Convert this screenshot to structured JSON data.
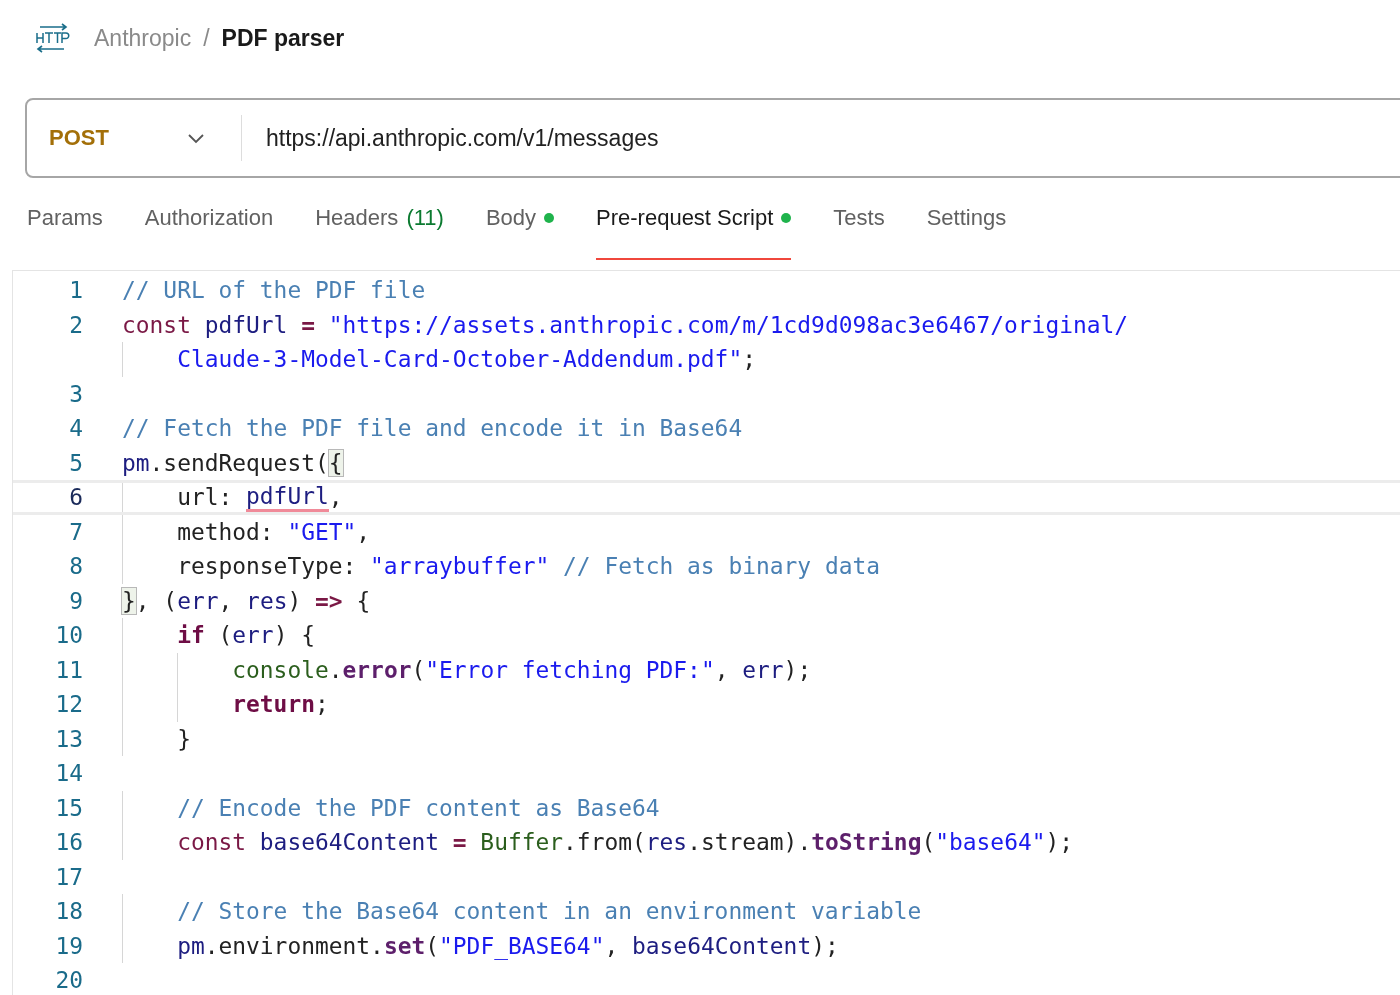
{
  "breadcrumb": {
    "workspace": "Anthropic",
    "separator": "/",
    "request_name": "PDF parser"
  },
  "request": {
    "method": "POST",
    "url": "https://api.anthropic.com/v1/messages"
  },
  "tabs": [
    {
      "label": "Params",
      "selected": false,
      "dot": false
    },
    {
      "label": "Authorization",
      "selected": false,
      "dot": false
    },
    {
      "label": "Headers",
      "count": "(11)",
      "selected": false,
      "dot": false
    },
    {
      "label": "Body",
      "selected": false,
      "dot": true
    },
    {
      "label": "Pre-request Script",
      "selected": true,
      "dot": true
    },
    {
      "label": "Tests",
      "selected": false,
      "dot": false
    },
    {
      "label": "Settings",
      "selected": false,
      "dot": false
    }
  ],
  "editor": {
    "lines": [
      {
        "number": "1",
        "active": false,
        "tokens": [
          {
            "kind": "comment",
            "text": "// URL of the PDF file"
          }
        ]
      },
      {
        "number": "2",
        "active": false,
        "tokens": [
          {
            "kind": "keyword",
            "text": "const"
          },
          {
            "kind": "variable",
            "text": " pdfUrl "
          },
          {
            "kind": "operator",
            "text": "="
          },
          {
            "kind": "string",
            "text": " \"https://assets.anthropic.com/m/1cd9d098ac3e6467/original/"
          }
        ]
      },
      {
        "active": false,
        "tokens": [
          {
            "kind": "string",
            "text": "    Claude-3-Model-Card-October-Addendum.pdf\""
          },
          {
            "kind": "plain",
            "text": ";"
          }
        ]
      },
      {
        "number": "3",
        "active": false
      },
      {
        "number": "4",
        "active": false,
        "tokens": [
          {
            "kind": "comment",
            "text": "// Fetch the PDF file and encode it in Base64"
          }
        ]
      },
      {
        "number": "5",
        "active": false,
        "tokens": [
          {
            "kind": "variable",
            "text": "pm"
          },
          {
            "kind": "plain",
            "text": ".sendRequest("
          },
          {
            "kind": "bracket",
            "text": "{"
          }
        ]
      },
      {
        "number": "6",
        "active": true,
        "tokens": [
          {
            "kind": "plain",
            "text": "    url: "
          },
          {
            "kind": "flagged",
            "text": "pdfUrl"
          },
          {
            "kind": "plain",
            "text": ","
          }
        ]
      },
      {
        "number": "7",
        "active": false,
        "tokens": [
          {
            "kind": "plain",
            "text": "    method: "
          },
          {
            "kind": "string",
            "text": "\"GET\""
          },
          {
            "kind": "plain",
            "text": ","
          }
        ]
      },
      {
        "number": "8",
        "active": false,
        "tokens": [
          {
            "kind": "plain",
            "text": "    responseType: "
          },
          {
            "kind": "string",
            "text": "\"arraybuffer\""
          },
          {
            "kind": "comment",
            "text": " // Fetch as binary data"
          }
        ]
      },
      {
        "number": "9",
        "active": false,
        "tokens": [
          {
            "kind": "bracket",
            "text": "}"
          },
          {
            "kind": "plain",
            "text": ", ("
          },
          {
            "kind": "variable",
            "text": "err"
          },
          {
            "kind": "plain",
            "text": ", "
          },
          {
            "kind": "variable",
            "text": "res"
          },
          {
            "kind": "plain",
            "text": ") "
          },
          {
            "kind": "operator",
            "text": "=>"
          },
          {
            "kind": "plain",
            "text": " {"
          }
        ]
      },
      {
        "number": "10",
        "active": false,
        "tokens": [
          {
            "kind": "control",
            "text": "    if"
          },
          {
            "kind": "plain",
            "text": " ("
          },
          {
            "kind": "variable",
            "text": "err"
          },
          {
            "kind": "plain",
            "text": ") {"
          }
        ]
      },
      {
        "number": "11",
        "active": false,
        "tokens": [
          {
            "kind": "builtin",
            "text": "        console"
          },
          {
            "kind": "plain",
            "text": "."
          },
          {
            "kind": "method",
            "text": "error"
          },
          {
            "kind": "plain",
            "text": "("
          },
          {
            "kind": "string",
            "text": "\"Error fetching PDF:\""
          },
          {
            "kind": "plain",
            "text": ", "
          },
          {
            "kind": "variable",
            "text": "err"
          },
          {
            "kind": "plain",
            "text": ");"
          }
        ]
      },
      {
        "number": "12",
        "active": false,
        "tokens": [
          {
            "kind": "control",
            "text": "        return"
          },
          {
            "kind": "plain",
            "text": ";"
          }
        ]
      },
      {
        "number": "13",
        "active": false,
        "tokens": [
          {
            "kind": "plain",
            "text": "    }"
          }
        ]
      },
      {
        "number": "14",
        "active": false
      },
      {
        "number": "15",
        "active": false,
        "tokens": [
          {
            "kind": "comment",
            "text": "    // Encode the PDF content as Base64"
          }
        ]
      },
      {
        "number": "16",
        "active": false,
        "tokens": [
          {
            "kind": "keyword",
            "text": "    const"
          },
          {
            "kind": "variable",
            "text": " base64Content "
          },
          {
            "kind": "operator",
            "text": "="
          },
          {
            "kind": "builtin",
            "text": " Buffer"
          },
          {
            "kind": "plain",
            "text": ".from("
          },
          {
            "kind": "variable",
            "text": "res"
          },
          {
            "kind": "plain",
            "text": ".stream)."
          },
          {
            "kind": "method",
            "text": "toString"
          },
          {
            "kind": "plain",
            "text": "("
          },
          {
            "kind": "string",
            "text": "\"base64\""
          },
          {
            "kind": "plain",
            "text": ");"
          }
        ]
      },
      {
        "number": "17",
        "active": false
      },
      {
        "number": "18",
        "active": false,
        "tokens": [
          {
            "kind": "comment",
            "text": "    // Store the Base64 content in an environment variable"
          }
        ]
      },
      {
        "number": "19",
        "active": false,
        "tokens": [
          {
            "kind": "variable",
            "text": "    pm"
          },
          {
            "kind": "plain",
            "text": ".environment."
          },
          {
            "kind": "method",
            "text": "set"
          },
          {
            "kind": "plain",
            "text": "("
          },
          {
            "kind": "string",
            "text": "\"PDF_BASE64\""
          },
          {
            "kind": "plain",
            "text": ", "
          },
          {
            "kind": "variable",
            "text": "base64Content"
          },
          {
            "kind": "plain",
            "text": ");"
          }
        ]
      },
      {
        "number": "20",
        "active": false
      }
    ]
  }
}
